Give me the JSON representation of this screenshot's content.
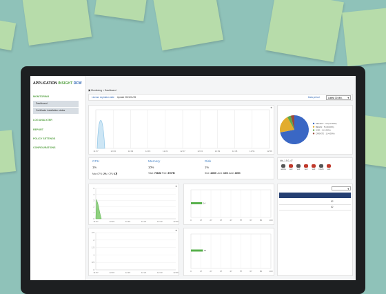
{
  "app": {
    "title_1": "APPLICATION",
    "title_2": "INSIGHT",
    "title_3": "DFW"
  },
  "sidebar": {
    "monitoring": "MONITORING",
    "dashboard": "Dashboard",
    "cert_status": "Certificate installation status",
    "log_analyzer": "LOG ANALYZER",
    "report": "REPORT",
    "policy": "POLICY SETTINGS",
    "config": "CONFIGURATIONS"
  },
  "breadcrumb": "Monitoring > Dashboard",
  "topbar": {
    "license_label": "License expiration date",
    "update_label": "Update 2021/01/25",
    "period_label": "Data period",
    "period_value": "Latest 30 Min."
  },
  "traffic_chart": {
    "x_ticks": [
      "11:57",
      "12:03",
      "12:09",
      "12:15",
      "12:21",
      "12:27",
      "12:33",
      "12:39",
      "12:45",
      "12:51",
      "12:56"
    ],
    "peak_fraction": 0.95
  },
  "pie": {
    "slices": [
      {
        "label": "SELECT : 18 (72.00%)",
        "value": 72,
        "color": "#3a67c4"
      },
      {
        "label": "BEGIN : 5 (20.00%)",
        "value": 20,
        "color": "#e2ac2e"
      },
      {
        "label": "USE : 1 (4.00%)",
        "value": 4,
        "color": "#5fa84a"
      },
      {
        "label": "CREATE : 1 (4.00%)",
        "value": 4,
        "color": "#9a4a3c"
      }
    ]
  },
  "resources": {
    "cpu": {
      "title": "CPU",
      "value": "1%",
      "d1_label": "Max CPU:",
      "d1_value": "2%",
      "d2_label": "/ CPU",
      "d2_value": "4개"
    },
    "memory": {
      "title": "Memory",
      "value": "10%",
      "d1_label": "Total:",
      "d1_value": "7934M",
      "d2_label": "Free:",
      "d2_value": "8707M"
    },
    "disk": {
      "title": "Disk",
      "value": "1%",
      "d1_label": "Size:",
      "d1_value": "430G",
      "d2_label": "Used:",
      "d2_value": "3.5G",
      "d3_label": "Avail:",
      "d3_value": "405G"
    }
  },
  "servers": {
    "label": "dbt_1.5.0_47",
    "items": [
      {
        "name": "wsDra",
        "color": "#555"
      },
      {
        "name": "ws0",
        "color": "#c0392b"
      },
      {
        "name": "ws1",
        "color": "#555"
      },
      {
        "name": "ws2",
        "color": "#c0392b"
      },
      {
        "name": "ws3",
        "color": "#c0392b"
      },
      {
        "name": "Intsch",
        "color": "#555"
      },
      {
        "name": "ws4",
        "color": "#c0392b"
      }
    ]
  },
  "small_chart_1": {
    "y_ticks": [
      "5",
      "4",
      "3",
      "2",
      "1",
      "0"
    ],
    "x_ticks": [
      "11:57",
      "12:03",
      "12:15",
      "12:21",
      "12:33",
      "12:56"
    ]
  },
  "small_chart_2": {
    "y_ticks": [
      "2.5",
      "2",
      "1.5",
      "1",
      "0.5",
      "0"
    ],
    "x_ticks": [
      "11:57",
      "12:03",
      "12:15",
      "12:21",
      "12:33",
      "12:56"
    ]
  },
  "hbar_1": {
    "bar_label": "14",
    "value_fraction": 0.14,
    "x_ticks": [
      "0",
      "17",
      "27",
      "37",
      "47",
      "57",
      "67",
      "80",
      "100"
    ]
  },
  "hbar_2": {
    "bar_label": "15",
    "value_fraction": 0.15,
    "x_ticks": [
      "0",
      "17",
      "27",
      "37",
      "47",
      "57",
      "67",
      "80",
      "100"
    ]
  },
  "right_list": {
    "row1_value": "82",
    "row2_value": "82"
  },
  "colors": {
    "accent_green": "#58a245",
    "accent_blue": "#3066b4",
    "navy": "#243f72"
  }
}
